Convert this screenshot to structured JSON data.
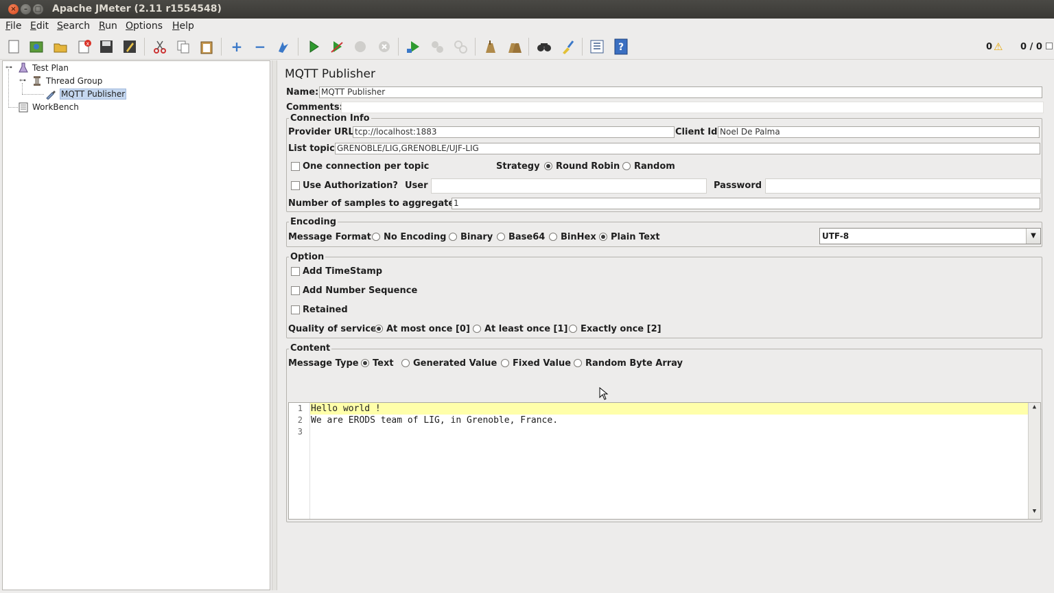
{
  "window": {
    "title": "Apache JMeter (2.11 r1554548)",
    "close": "×",
    "minimize": "–",
    "maximize": "□"
  },
  "menu": [
    "File",
    "Edit",
    "Search",
    "Run",
    "Options",
    "Help"
  ],
  "toolbar": {
    "icons": [
      "new-icon",
      "templates-icon",
      "open-icon",
      "close-icon",
      "save-icon",
      "save-as-icon",
      "cut-icon",
      "copy-icon",
      "paste-icon",
      "expand-icon",
      "collapse-icon",
      "toggle-icon",
      "start-icon",
      "start-no-timers-icon",
      "stop-icon",
      "shutdown-icon",
      "remote-start-icon",
      "remote-stop-icon",
      "remote-shutdown-icon",
      "clear-icon",
      "clear-all-icon",
      "search-icon",
      "reset-search-icon",
      "function-helper-icon",
      "help-icon"
    ],
    "error_count": "0",
    "threads": "0 / 0"
  },
  "tree": {
    "test_plan": "Test Plan",
    "thread_group": "Thread Group",
    "mqtt_publisher": "MQTT Publisher",
    "workbench": "WorkBench"
  },
  "panel": {
    "title": "MQTT Publisher",
    "name_label": "Name:",
    "name_value": "MQTT Publisher",
    "comments_label": "Comments:",
    "comments_value": "",
    "connection": {
      "title": "Connection Info",
      "provider_url_label": "Provider URL",
      "provider_url_value": "tcp://localhost:1883",
      "client_id_label": "Client Id",
      "client_id_value": "Noel De Palma",
      "list_topic_label": "List topic",
      "list_topic_value": "GRENOBLE/LIG,GRENOBLE/UJF-LIG",
      "one_conn_label": "One connection per topic",
      "one_conn_checked": false,
      "strategy_label": "Strategy",
      "strategy_options": [
        "Round Robin",
        "Random"
      ],
      "strategy_selected": "Round Robin",
      "use_auth_label": "Use Authorization?",
      "use_auth_checked": false,
      "user_label": "User",
      "user_value": "",
      "password_label": "Password",
      "password_value": "",
      "samples_label": "Number of samples to aggregate",
      "samples_value": "1"
    },
    "encoding": {
      "title": "Encoding",
      "format_label": "Message Format",
      "options": [
        "No Encoding",
        "Binary",
        "Base64",
        "BinHex",
        "Plain Text"
      ],
      "selected": "Plain Text",
      "charset": "UTF-8"
    },
    "option": {
      "title": "Option",
      "add_timestamp": "Add TimeStamp",
      "add_number_sequence": "Add Number Sequence",
      "retained": "Retained",
      "qos_label": "Quality of service",
      "qos_options": [
        "At most once [0]",
        "At least once [1]",
        "Exactly once [2]"
      ],
      "qos_selected": "At most once [0]"
    },
    "content": {
      "title": "Content",
      "type_label": "Message Type",
      "type_options": [
        "Text",
        "Generated Value",
        "Fixed Value",
        "Random Byte Array"
      ],
      "type_selected": "Text",
      "lines": [
        "Hello world !",
        "We are ERODS team of LIG, in Grenoble, France.",
        ""
      ],
      "line_numbers": [
        "1",
        "2",
        "3"
      ]
    }
  }
}
